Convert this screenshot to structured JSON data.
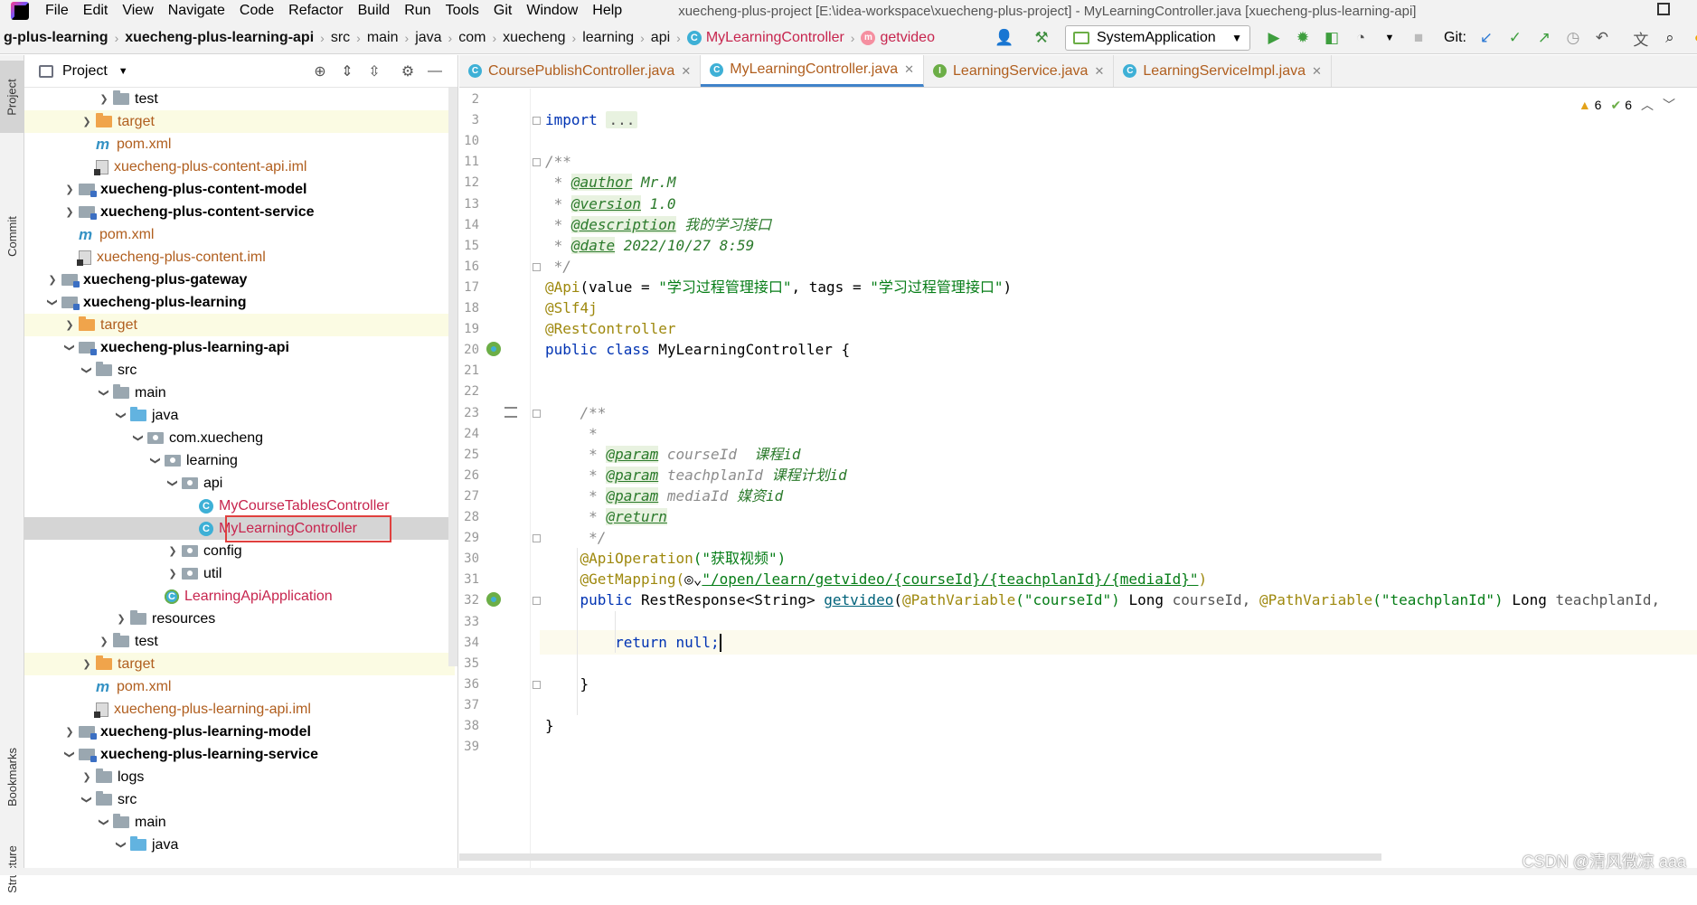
{
  "menubar": {
    "items": [
      "File",
      "Edit",
      "View",
      "Navigate",
      "Code",
      "Refactor",
      "Build",
      "Run",
      "Tools",
      "Git",
      "Window",
      "Help"
    ],
    "title": "xuecheng-plus-project [E:\\idea-workspace\\xuecheng-plus-project] - MyLearningController.java [xuecheng-plus-learning-api]"
  },
  "navbar": {
    "crumbs": [
      "g-plus-learning",
      "xuecheng-plus-learning-api",
      "src",
      "main",
      "java",
      "com",
      "xuecheng",
      "learning",
      "api",
      "MyLearningController",
      "getvideo"
    ],
    "run_config": "SystemApplication",
    "git_label": "Git:"
  },
  "left_strip": {
    "project": "Project",
    "commit": "Commit",
    "bookmarks": "Bookmarks",
    "structure": "Structure"
  },
  "project_panel": {
    "title": "Project",
    "rows": [
      {
        "label": "test",
        "icon": "folder",
        "arrow": "right",
        "depth": 4,
        "style": ""
      },
      {
        "label": "target",
        "icon": "orange",
        "arrow": "right",
        "depth": 3,
        "style": "orange",
        "hl": true
      },
      {
        "label": "pom.xml",
        "icon": "maven",
        "arrow": "",
        "depth": 3,
        "style": "orange"
      },
      {
        "label": "xuecheng-plus-content-api.iml",
        "icon": "iml",
        "arrow": "",
        "depth": 3,
        "style": "orange"
      },
      {
        "label": "xuecheng-plus-content-model",
        "icon": "module",
        "arrow": "right",
        "depth": 2,
        "style": "bold"
      },
      {
        "label": "xuecheng-plus-content-service",
        "icon": "module",
        "arrow": "right",
        "depth": 2,
        "style": "bold"
      },
      {
        "label": "pom.xml",
        "icon": "maven",
        "arrow": "",
        "depth": 2,
        "style": "orange"
      },
      {
        "label": "xuecheng-plus-content.iml",
        "icon": "iml",
        "arrow": "",
        "depth": 2,
        "style": "orange"
      },
      {
        "label": "xuecheng-plus-gateway",
        "icon": "module",
        "arrow": "right",
        "depth": 1,
        "style": "bold"
      },
      {
        "label": "xuecheng-plus-learning",
        "icon": "module",
        "arrow": "down",
        "depth": 1,
        "style": "bold"
      },
      {
        "label": "target",
        "icon": "orange",
        "arrow": "right",
        "depth": 2,
        "style": "orange",
        "hl": true
      },
      {
        "label": "xuecheng-plus-learning-api",
        "icon": "module",
        "arrow": "down",
        "depth": 2,
        "style": "bold"
      },
      {
        "label": "src",
        "icon": "folder",
        "arrow": "down",
        "depth": 3,
        "style": ""
      },
      {
        "label": "main",
        "icon": "folder",
        "arrow": "down",
        "depth": 4,
        "style": ""
      },
      {
        "label": "java",
        "icon": "blue",
        "arrow": "down",
        "depth": 5,
        "style": ""
      },
      {
        "label": "com.xuecheng",
        "icon": "pkg",
        "arrow": "down",
        "depth": 6,
        "style": ""
      },
      {
        "label": "learning",
        "icon": "pkg",
        "arrow": "down",
        "depth": 7,
        "style": ""
      },
      {
        "label": "api",
        "icon": "pkg",
        "arrow": "down",
        "depth": 8,
        "style": ""
      },
      {
        "label": "MyCourseTablesController",
        "icon": "class",
        "arrow": "",
        "depth": 9,
        "style": "red"
      },
      {
        "label": "MyLearningController",
        "icon": "class",
        "arrow": "",
        "depth": 9,
        "style": "red",
        "selected": true
      },
      {
        "label": "config",
        "icon": "pkg",
        "arrow": "right",
        "depth": 8,
        "style": ""
      },
      {
        "label": "util",
        "icon": "pkg",
        "arrow": "right",
        "depth": 8,
        "style": ""
      },
      {
        "label": "LearningApiApplication",
        "icon": "app",
        "arrow": "",
        "depth": 7,
        "style": "red"
      },
      {
        "label": "resources",
        "icon": "folder",
        "arrow": "right",
        "depth": 5,
        "style": ""
      },
      {
        "label": "test",
        "icon": "folder",
        "arrow": "right",
        "depth": 4,
        "style": ""
      },
      {
        "label": "target",
        "icon": "orange",
        "arrow": "right",
        "depth": 3,
        "style": "orange",
        "hl": true
      },
      {
        "label": "pom.xml",
        "icon": "maven",
        "arrow": "",
        "depth": 3,
        "style": "orange"
      },
      {
        "label": "xuecheng-plus-learning-api.iml",
        "icon": "iml",
        "arrow": "",
        "depth": 3,
        "style": "orange"
      },
      {
        "label": "xuecheng-plus-learning-model",
        "icon": "module",
        "arrow": "right",
        "depth": 2,
        "style": "bold"
      },
      {
        "label": "xuecheng-plus-learning-service",
        "icon": "module",
        "arrow": "down",
        "depth": 2,
        "style": "bold"
      },
      {
        "label": "logs",
        "icon": "folder",
        "arrow": "right",
        "depth": 3,
        "style": ""
      },
      {
        "label": "src",
        "icon": "folder",
        "arrow": "down",
        "depth": 3,
        "style": ""
      },
      {
        "label": "main",
        "icon": "folder",
        "arrow": "down",
        "depth": 4,
        "style": ""
      },
      {
        "label": "java",
        "icon": "blue",
        "arrow": "down",
        "depth": 5,
        "style": ""
      }
    ]
  },
  "tabs": [
    {
      "label": "CoursePublishController.java",
      "kind": "class",
      "active": false
    },
    {
      "label": "MyLearningController.java",
      "kind": "class",
      "active": true
    },
    {
      "label": "LearningService.java",
      "kind": "interface",
      "active": false
    },
    {
      "label": "LearningServiceImpl.java",
      "kind": "class",
      "active": false
    }
  ],
  "editor": {
    "inspections": {
      "warnings": "6",
      "ok": "6"
    },
    "line_numbers": [
      "2",
      "3",
      "10",
      "11",
      "12",
      "13",
      "14",
      "15",
      "16",
      "17",
      "18",
      "19",
      "20",
      "21",
      "22",
      "23",
      "24",
      "25",
      "26",
      "27",
      "28",
      "29",
      "30",
      "31",
      "32",
      "33",
      "34",
      "35",
      "36",
      "37",
      "38",
      "39"
    ],
    "code": {
      "import_kw": "import",
      "import_fold": "...",
      "doc_open": "/**",
      "author_tag": "@author",
      "author_val": "Mr.M",
      "version_tag": "@version",
      "version_val": "1.0",
      "description_tag": "@description",
      "description_val": "我的学习接口",
      "date_tag": "@date",
      "date_val": "2022/10/27 8:59",
      "doc_close": "*/",
      "api_ann": "@Api",
      "api_args_a": "(value = ",
      "api_value": "\"学习过程管理接口\"",
      "api_args_b": ", tags = ",
      "api_tags": "\"学习过程管理接口\"",
      "api_close": ")",
      "slf4j": "@Slf4j",
      "rest_controller": "@RestController",
      "class_kw": "public class",
      "class_name": "MyLearningController {",
      "m_doc_open": "/**",
      "m_star": "*",
      "param_tag": "@param",
      "p1_name": "courseId",
      "p1_desc": "课程id",
      "p2_name": "teachplanId",
      "p2_desc": "课程计划id",
      "p3_name": "mediaId",
      "p3_desc": "媒资id",
      "return_tag": "@return",
      "m_doc_close": "*/",
      "api_op": "@ApiOperation",
      "api_op_val": "(\"获取视频\")",
      "get_mapping": "@GetMapping(",
      "get_mapping_url": "\"/open/learn/getvideo/{courseId}/{teachplanId}/{mediaId}\"",
      "get_mapping_close": ")",
      "sig_kw": "public",
      "sig_type": "RestResponse<String>",
      "sig_fn": "getvideo",
      "sig_open": "(",
      "pv1": "@PathVariable",
      "pv1_arg": "(\"courseId\")",
      "pv1_type": "Long",
      "pv1_name": "courseId,",
      "pv2": "@PathVariable",
      "pv2_arg": "(\"teachplanId\")",
      "pv2_type": "Long",
      "pv2_name": "teachplanId,",
      "return_kw": "return",
      "return_val": "null;",
      "m_close": "}",
      "class_close": "}"
    }
  },
  "watermark": "CSDN @清风微凉 aaa"
}
